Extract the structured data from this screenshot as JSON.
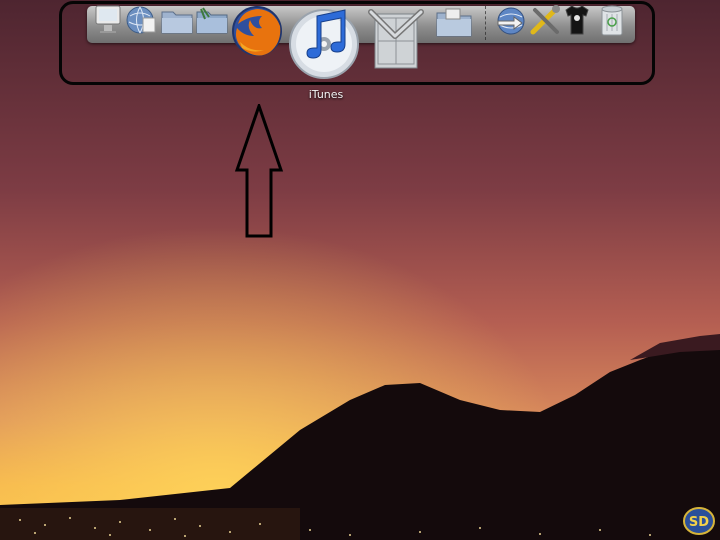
{
  "dock": {
    "hovered_label": "iTunes",
    "items": [
      {
        "icon": "display-prefs-icon"
      },
      {
        "icon": "network-globe-icon"
      },
      {
        "icon": "folder-icon"
      },
      {
        "icon": "applications-folder-icon"
      },
      {
        "icon": "firefox-icon"
      },
      {
        "icon": "itunes-icon"
      },
      {
        "icon": "utilities-tools-icon"
      },
      {
        "icon": "documents-folder-icon"
      },
      {
        "icon": "globe-arrow-icon"
      },
      {
        "icon": "tools-icon"
      },
      {
        "icon": "tshirt-icon"
      },
      {
        "icon": "trash-icon"
      }
    ]
  },
  "colors": {
    "sky_top": "#5a2a33",
    "sky_mid": "#b85a4e",
    "horizon": "#f2a64a",
    "mountain": "#120a0c",
    "highlight_border": "#050505",
    "arrow_stroke": "#000000"
  }
}
